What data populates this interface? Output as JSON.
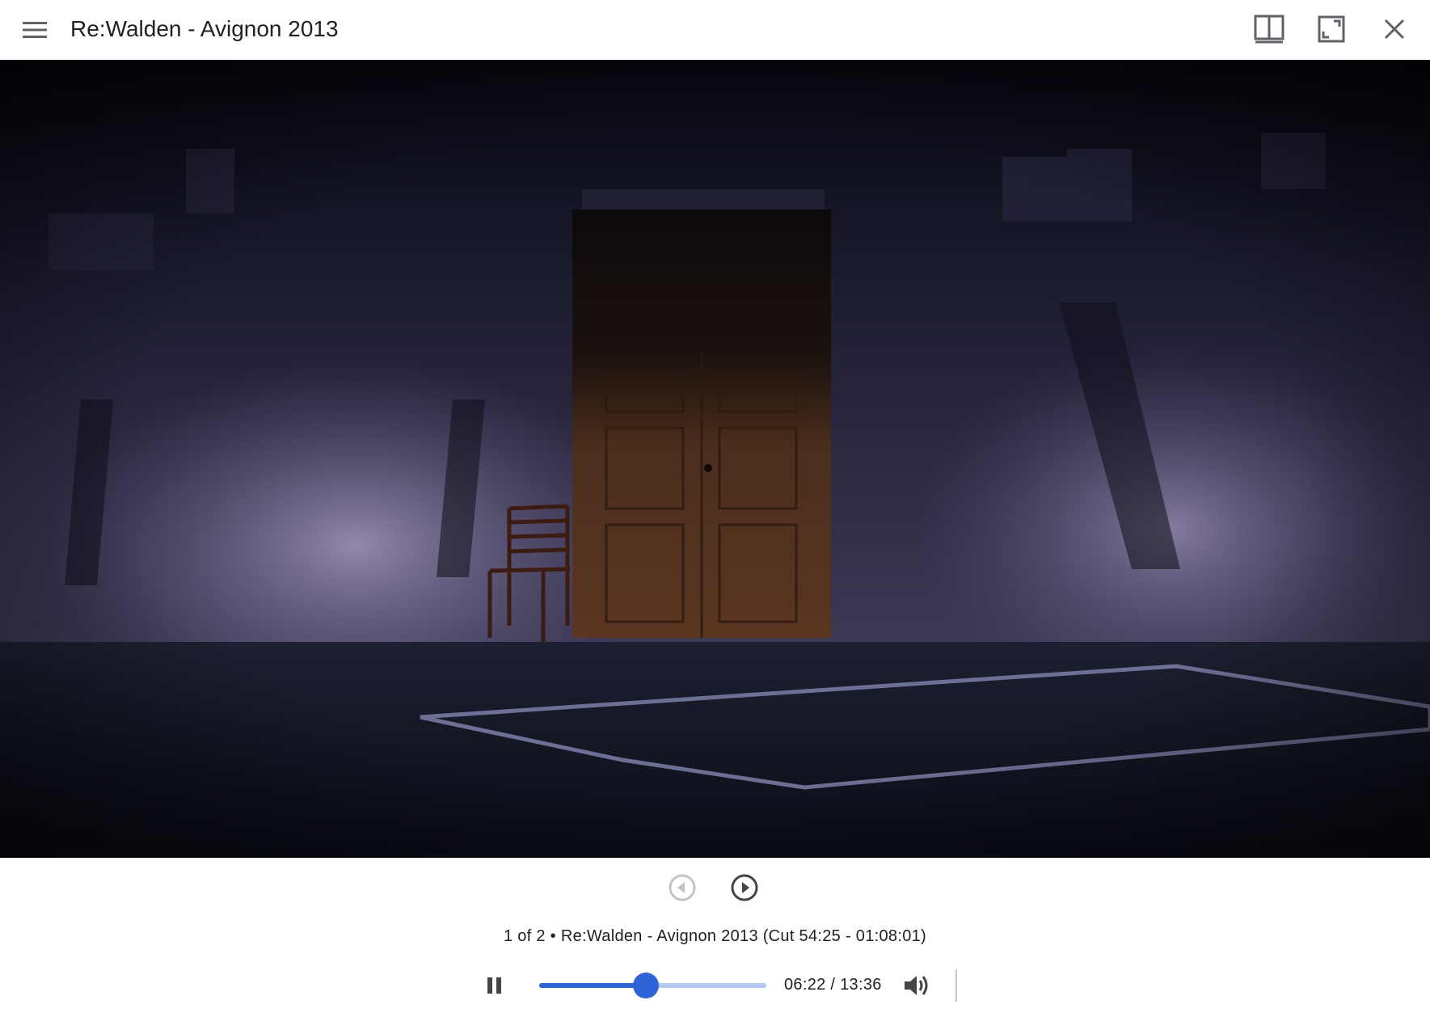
{
  "header": {
    "title": "Re:Walden - Avignon 2013",
    "icons": [
      "menu-icon",
      "split-view-icon",
      "fullscreen-icon",
      "close-icon"
    ]
  },
  "viewer": {
    "content": "video-frame"
  },
  "navigation": {
    "previous_icon": "previous-icon",
    "next_icon": "next-icon",
    "previous_enabled": false,
    "next_enabled": true
  },
  "caption": "1 of 2 • Re:Walden - Avignon 2013 (Cut 54:25 - 01:08:01)",
  "player": {
    "play_state_icon": "pause-icon",
    "volume_icon": "volume-icon",
    "time_display": "06:22 / 13:36",
    "progress_fraction": 0.468,
    "accent_color": "#2f63d6"
  }
}
